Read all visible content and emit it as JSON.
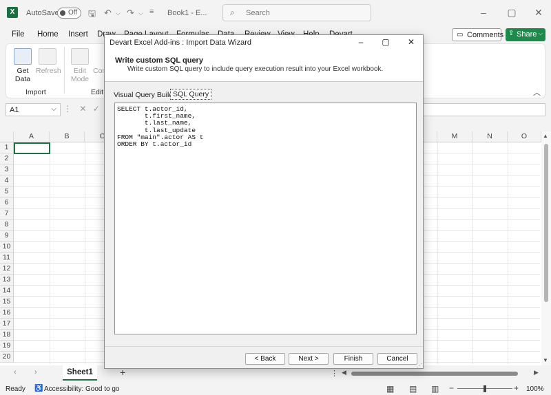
{
  "titlebar": {
    "autosave_label": "AutoSave",
    "autosave_state": "Off",
    "book_title": "Book1 - E...",
    "search_placeholder": "Search"
  },
  "ribbon_tabs": [
    "File",
    "Home",
    "Insert",
    "Draw",
    "Page Layout",
    "Formulas",
    "Data",
    "Review",
    "View",
    "Help",
    "Devart"
  ],
  "buttons": {
    "comments": "Comments",
    "share": "Share"
  },
  "ribbon": {
    "get_data": [
      "Get",
      "Data"
    ],
    "refresh": "Refresh",
    "edit_mode": [
      "Edit",
      "Mode"
    ],
    "commit": "Com",
    "group_import": "Import",
    "group_edit": "Edit S"
  },
  "formula_bar": {
    "name_box": "A1"
  },
  "grid": {
    "columns_left": [
      "A",
      "B",
      "C"
    ],
    "columns_right": [
      "M",
      "N",
      "O"
    ],
    "rows": [
      "1",
      "2",
      "3",
      "4",
      "5",
      "6",
      "7",
      "8",
      "9",
      "10",
      "11",
      "12",
      "13",
      "14",
      "15",
      "16",
      "17",
      "18",
      "19",
      "20"
    ]
  },
  "sheet_tab": "Sheet1",
  "statusbar": {
    "ready": "Ready",
    "accessibility": "Accessibility: Good to go",
    "zoom": "100%"
  },
  "dialog": {
    "title": "Devart Excel Add-ins : Import Data Wizard",
    "heading": "Write custom SQL query",
    "description": "Write custom SQL query to include query execution result into your Excel workbook.",
    "tab_visual": "Visual Query Builder",
    "tab_sql": "SQL Query",
    "sql_lines": [
      "SELECT t.actor_id,",
      "       t.first_name,",
      "       t.last_name,",
      "       t.last_update",
      "FROM \"main\".actor AS t",
      "ORDER BY t.actor_id"
    ],
    "back": "< Back",
    "next": "Next >",
    "finish": "Finish",
    "cancel": "Cancel"
  }
}
